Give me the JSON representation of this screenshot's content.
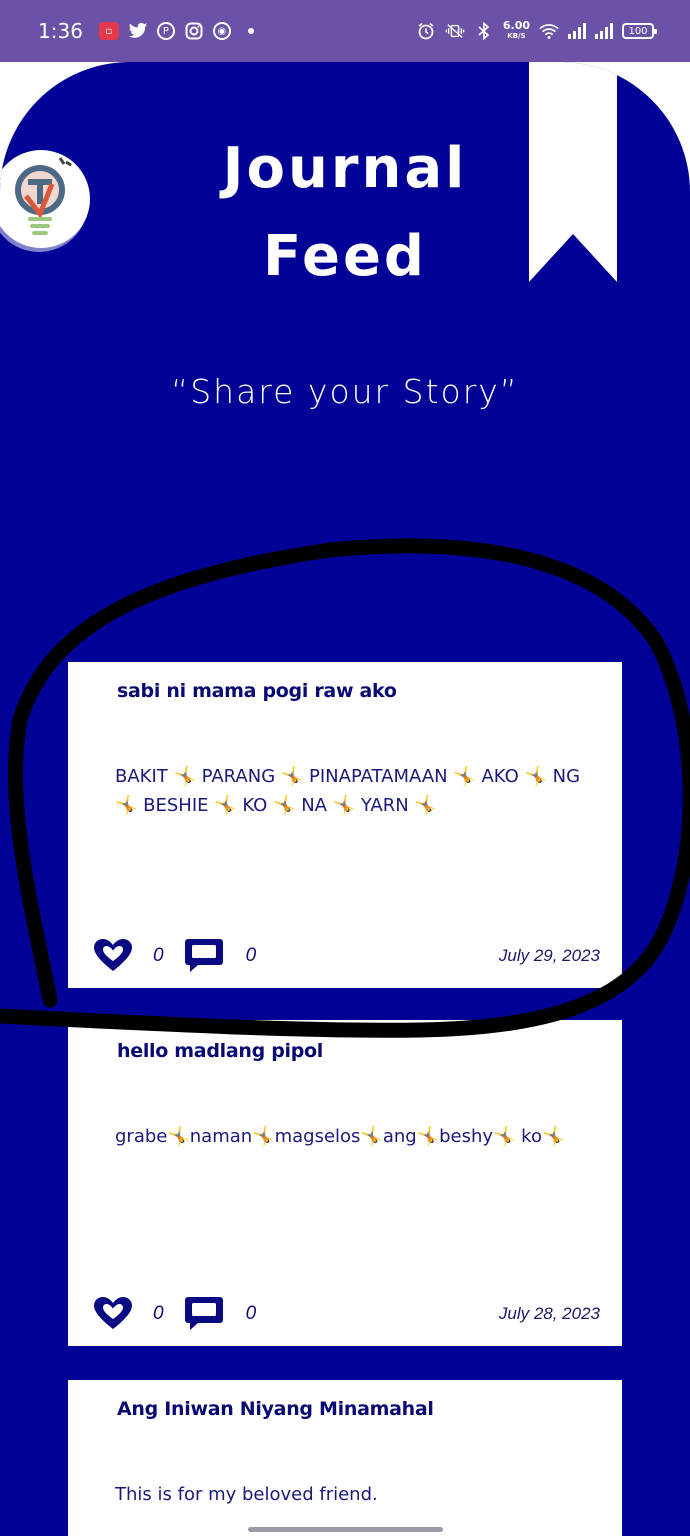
{
  "status_bar": {
    "time": "1:36",
    "network_speed": "6.00",
    "network_speed_unit": "KB/S",
    "battery": "100"
  },
  "header": {
    "title_line1": "Journal",
    "title_line2": "Feed",
    "tagline": "“Share your Story”"
  },
  "posts": [
    {
      "title": "sabi ni mama pogi raw ako",
      "body": "BAKIT 🤸 PARANG 🤸 PINAPATAMAAN 🤸 AKO 🤸 NG 🤸 BESHIE 🤸 KO 🤸 NA 🤸 YARN 🤸",
      "likes": "0",
      "comments": "0",
      "date": "July 29, 2023"
    },
    {
      "title": "hello madlang pipol",
      "body": "grabe🤸naman🤸magselos🤸ang🤸beshy🤸 ko🤸",
      "likes": "0",
      "comments": "0",
      "date": "July 28, 2023"
    },
    {
      "title": "Ang Iniwan Niyang Minamahal",
      "body": "This is for my beloved friend."
    }
  ],
  "colors": {
    "status_bar": "#6a52a6",
    "background": "#020296",
    "card": "#ffffff",
    "accent": "#0a0a75"
  }
}
